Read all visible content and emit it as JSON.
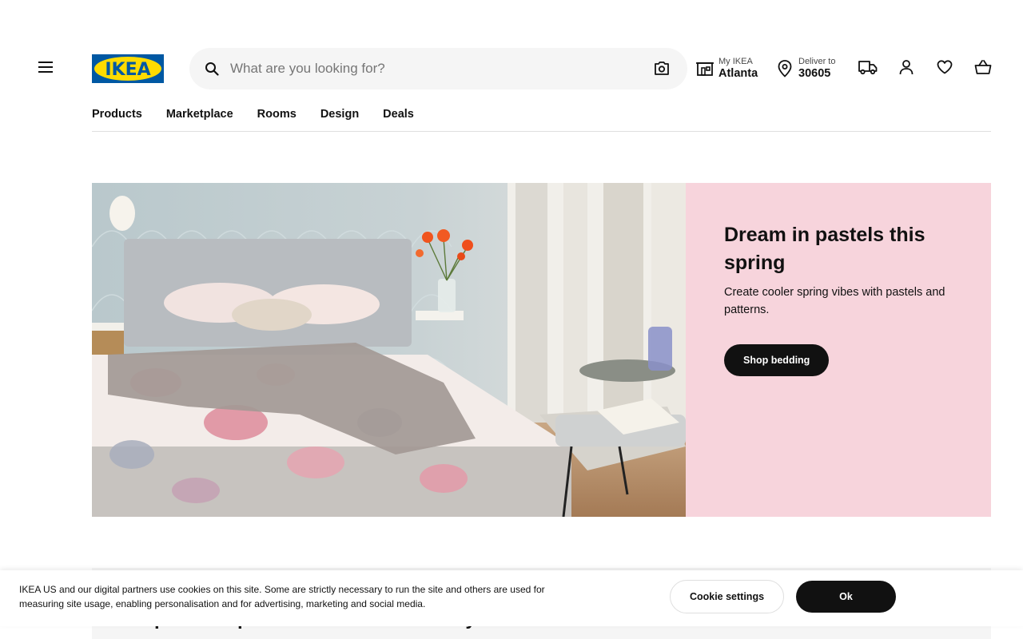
{
  "brand": {
    "logo_text": "IKEA",
    "logo_blue": "#0058a3",
    "logo_yellow": "#ffdb00"
  },
  "icons": {
    "menu": "hamburger-menu-icon",
    "search": "search-icon",
    "camera": "camera-icon",
    "store": "store-icon",
    "location": "location-pin-icon",
    "delivery": "truck-icon",
    "account": "user-icon",
    "wishlist": "heart-icon",
    "cart": "shopping-basket-icon"
  },
  "header": {
    "search_placeholder": "What are you looking for?",
    "my_ikea": {
      "small": "My IKEA",
      "big": "Atlanta"
    },
    "deliver": {
      "small": "Deliver to",
      "big": "30605"
    }
  },
  "nav": {
    "items": [
      {
        "label": "Products"
      },
      {
        "label": "Marketplace"
      },
      {
        "label": "Rooms"
      },
      {
        "label": "Design"
      },
      {
        "label": "Deals"
      }
    ]
  },
  "hero": {
    "title": "Dream in pastels this spring",
    "subtitle": "Create cooler spring vibes with pastels and patterns.",
    "cta_label": "Shop bedding",
    "panel_color": "#f7d4dc"
  },
  "next_section": {
    "title": "Important update on stock availability"
  },
  "cookie": {
    "message": "IKEA US and our digital partners use cookies on this site. Some are strictly necessary to run the site and others are used for measuring site usage, enabling personalisation and for advertising, marketing and social media.",
    "settings_label": "Cookie settings",
    "ok_label": "Ok"
  }
}
